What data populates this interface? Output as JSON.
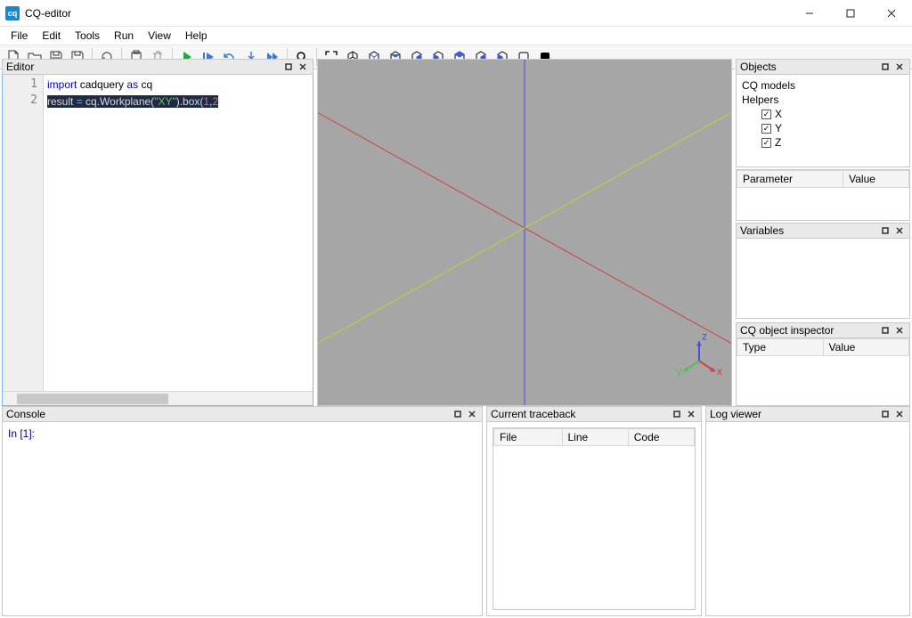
{
  "window": {
    "title": "CQ-editor"
  },
  "menu": {
    "items": [
      "File",
      "Edit",
      "Tools",
      "Run",
      "View",
      "Help"
    ]
  },
  "toolbar": {
    "groups": [
      [
        "new-file-icon",
        "open-file-icon",
        "save-icon",
        "save-as-icon"
      ],
      [
        "autoreload-icon"
      ],
      [
        "paste-icon",
        "trash-icon"
      ],
      [
        "play-icon",
        "step-icon",
        "undo-icon",
        "step-in-icon",
        "continue-icon"
      ],
      [
        "search-zoom-icon"
      ],
      [
        "fit-icon",
        "iso-icon",
        "iso2-icon",
        "top-icon",
        "bottom-icon",
        "front-icon",
        "back-icon",
        "left-icon",
        "right-icon",
        "wire-icon",
        "solid-icon"
      ]
    ]
  },
  "editor": {
    "title": "Editor",
    "line_numbers": [
      "1",
      "2"
    ],
    "code": {
      "line1_parts": {
        "kw_import": "import",
        "sp1": " ",
        "mod": "cadquery",
        "sp2": " ",
        "kw_as": "as",
        "sp3": " ",
        "alias": "cq"
      },
      "line2_parts": {
        "a": "result ",
        "eq": "=",
        "b": " cq.Workplane(",
        "str": "\"XY\"",
        "c": ").box(",
        "n1": "1",
        "d": ",",
        "n2": "2"
      }
    }
  },
  "viewport": {
    "axis_labels": {
      "x": "x",
      "y": "y",
      "z": "z"
    }
  },
  "objects_panel": {
    "title": "Objects",
    "root": "CQ models",
    "helpers_label": "Helpers",
    "helpers": [
      {
        "label": "X",
        "checked": "✓"
      },
      {
        "label": "Y",
        "checked": "✓"
      },
      {
        "label": "Z",
        "checked": "✓"
      }
    ],
    "param_header": "Parameter",
    "value_header": "Value"
  },
  "variables_panel": {
    "title": "Variables"
  },
  "inspector_panel": {
    "title": "CQ object inspector",
    "col_type": "Type",
    "col_value": "Value"
  },
  "console_panel": {
    "title": "Console",
    "prompt": "In [1]:"
  },
  "traceback_panel": {
    "title": "Current traceback",
    "cols": {
      "file": "File",
      "line": "Line",
      "code": "Code"
    }
  },
  "log_panel": {
    "title": "Log viewer"
  }
}
